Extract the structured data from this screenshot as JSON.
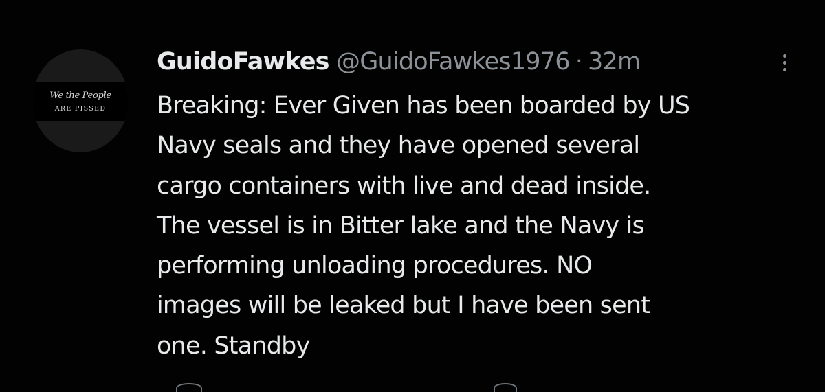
{
  "tweet": {
    "avatar": {
      "logo_line1": "We the People",
      "logo_line2": "ARE PISSED"
    },
    "author_name": "GuidoFawkes",
    "author_handle": "@GuidoFawkes1976",
    "separator": "·",
    "timestamp": "32m",
    "body_lines": [
      "Breaking: Ever Given has been boarded by US",
      "Navy seals and they have opened several",
      "cargo containers with live and dead inside.",
      "The vessel is in Bitter lake and the Navy is",
      "performing unloading procedures. NO",
      "images will be leaked but I have been sent",
      "one. Standby"
    ],
    "more_icon": "more-vertical-icon"
  },
  "colors": {
    "background": "#020202",
    "text_primary": "#e7e9ea",
    "text_secondary": "#8b9196"
  }
}
